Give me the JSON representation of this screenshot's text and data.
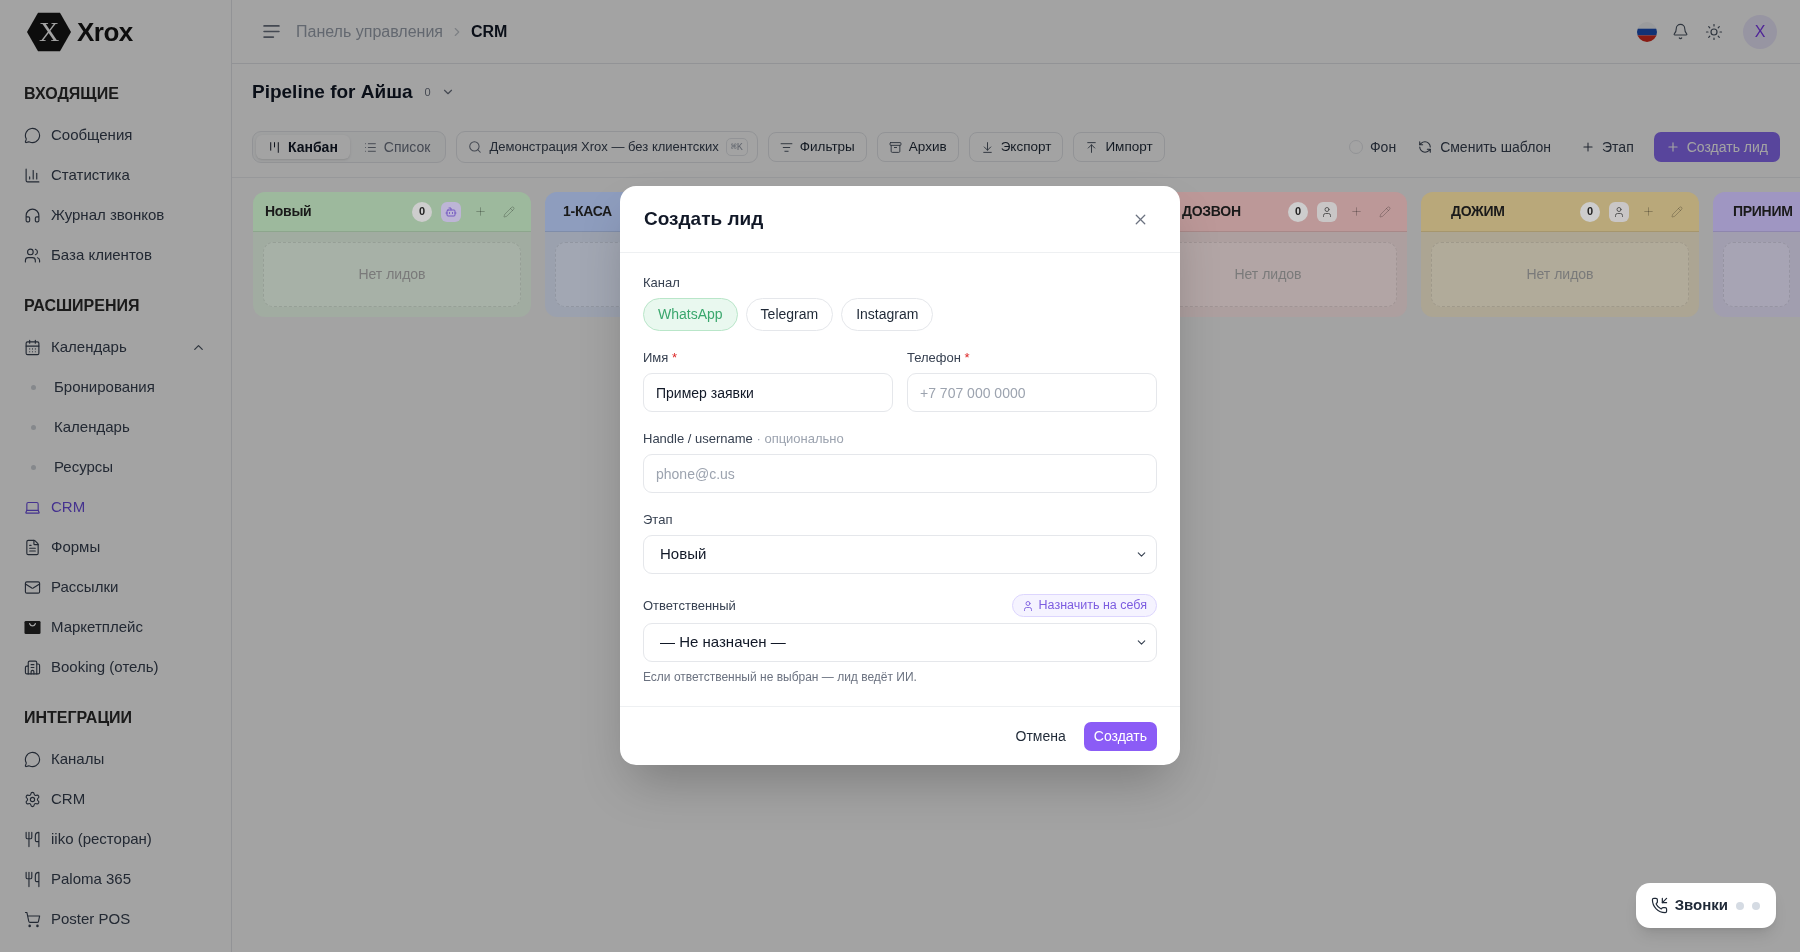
{
  "sidebar": {
    "logo": {
      "mark": "X",
      "name": "Xrox"
    },
    "sections": [
      {
        "title": "ВХОДЯЩИЕ",
        "items": [
          {
            "label": "Сообщения",
            "selected": false
          },
          {
            "label": "Статистика",
            "selected": false
          },
          {
            "label": "Журнал звонков",
            "selected": false
          },
          {
            "label": "База клиентов",
            "selected": false
          }
        ]
      },
      {
        "title": "РАСШИРЕНИЯ",
        "items": [
          {
            "label": "Календарь",
            "selected": false,
            "expanded": true,
            "children": [
              {
                "label": "Бронирования",
                "selected": false
              },
              {
                "label": "Календарь",
                "selected": false
              },
              {
                "label": "Ресурсы",
                "selected": false
              }
            ]
          },
          {
            "label": "CRM",
            "selected": true
          },
          {
            "label": "Формы",
            "selected": false
          },
          {
            "label": "Рассылки",
            "selected": false
          },
          {
            "label": "Маркетплейс",
            "selected": false
          },
          {
            "label": "Booking (отель)",
            "selected": false
          }
        ]
      },
      {
        "title": "ИНТЕГРАЦИИ",
        "items": [
          {
            "label": "Каналы",
            "selected": false
          },
          {
            "label": "CRM",
            "selected": false
          },
          {
            "label": "iiko (ресторан)",
            "selected": false
          },
          {
            "label": "Paloma 365",
            "selected": false
          },
          {
            "label": "Poster POS",
            "selected": false
          }
        ]
      }
    ]
  },
  "header": {
    "breadcrumb": [
      {
        "label": "Панель управления",
        "current": false
      },
      {
        "label": "CRM",
        "current": true
      }
    ],
    "avatar_initial": "X"
  },
  "pipeline": {
    "title": "Pipeline for Айша",
    "count": "0"
  },
  "toolbar": {
    "views": [
      {
        "label": "Канбан",
        "selected": true
      },
      {
        "label": "Список",
        "selected": false
      }
    ],
    "search": {
      "value": "Демонстрация Xrox — без клиентских",
      "shortcut": "⌘K"
    },
    "actions": [
      "Фильтры",
      "Архив",
      "Экспорт",
      "Импорт"
    ],
    "background_toggle": {
      "label": "Фон",
      "checked": false
    },
    "template_button": "Сменить шаблон",
    "stage_button": "Этап",
    "create_button": "Создать лид"
  },
  "board": {
    "columns": [
      {
        "title": "Новый",
        "color": "#9db99d",
        "count": "0",
        "assignee": {
          "kind": "ai"
        },
        "empty_text": "Нет лидов"
      },
      {
        "title": "1-КАСА",
        "color": "#8e9dbe"
      },
      {
        "title": "ДОЗВОН",
        "color": "#bc9898",
        "count": "0",
        "assignee": {
          "kind": "person"
        },
        "empty_text": "Нет лидов"
      },
      {
        "title": "ДОЖИМ",
        "color": "#b9a87a",
        "count": "0",
        "assignee": {
          "kind": "person"
        },
        "empty_text": "Нет лидов"
      },
      {
        "title": "ПРИНИМ",
        "color": "#9f96c2"
      }
    ]
  },
  "modal": {
    "title": "Создать лид",
    "channel": {
      "label": "Канал",
      "options": [
        {
          "label": "WhatsApp",
          "selected": true
        },
        {
          "label": "Telegram",
          "selected": false
        },
        {
          "label": "Instagram",
          "selected": false
        }
      ]
    },
    "rows": [
      [
        {
          "kind": "text",
          "label": "Имя",
          "required_mark": "*",
          "value": "Пример заявки"
        },
        {
          "kind": "text",
          "label": "Телефон",
          "required_mark": "*",
          "placeholder": "+7 707 000 0000"
        }
      ],
      [
        {
          "kind": "text",
          "label": "Handle / username",
          "note": "· опционально",
          "placeholder": "phone@c.us"
        }
      ],
      [
        {
          "kind": "select",
          "label": "Этап",
          "value": "Новый"
        }
      ],
      [
        {
          "kind": "select",
          "label": "Ответственный",
          "value": "— Не назначен —",
          "action": "Назначить на себя",
          "help": "Если ответственный не выбран — лид ведёт ИИ."
        }
      ]
    ],
    "cancel_button": "Отмена",
    "submit_button": "Создать"
  },
  "calls_widget": {
    "label": "Звонки"
  }
}
